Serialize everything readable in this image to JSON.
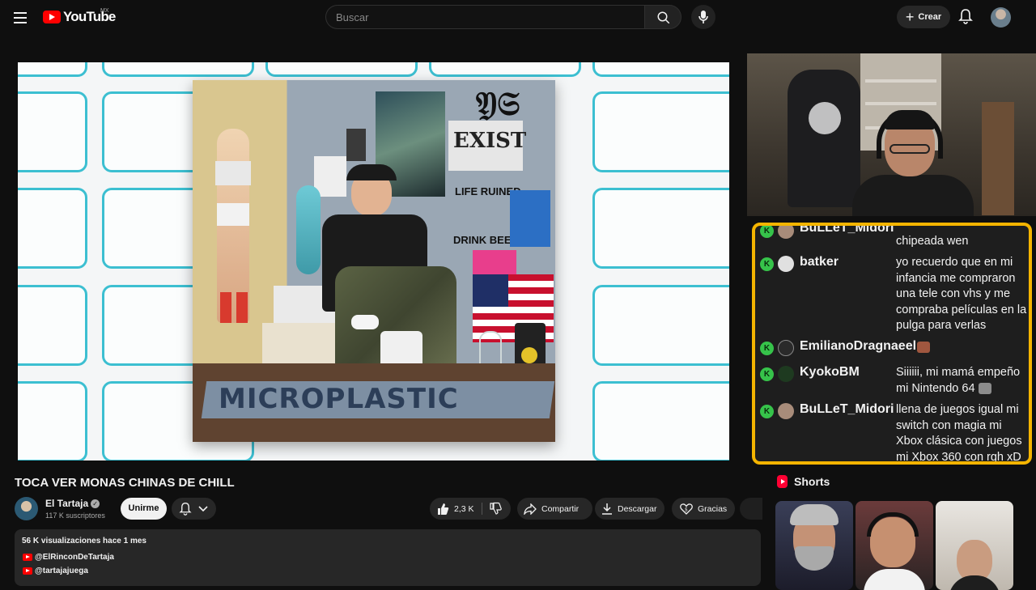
{
  "header": {
    "logo_text": "YouTube",
    "country_code": "MX",
    "search_placeholder": "Buscar",
    "create_label": "Crear"
  },
  "player": {
    "album_text": "MICROPLASTIC",
    "poster_texts": [
      "EXIST",
      "LIFE RUINED",
      "DRINK BEER"
    ]
  },
  "chat": {
    "messages": [
      {
        "user": "BuLLeT_Midori",
        "text": "chipeada wen",
        "badge": "K",
        "accent": "#36c34a"
      },
      {
        "user": "batker",
        "text": "yo recuerdo que en mi infancia me compraron una tele con vhs y me compraba películas en la pulga para verlas",
        "badge": "K",
        "accent": "#36c34a"
      },
      {
        "user": "EmilianoDragnaeel",
        "text": "",
        "badge": "K",
        "accent": "#36c34a"
      },
      {
        "user": "KyokoBM",
        "text": "Siiiiii, mi mamá empeño mi Nintendo 64",
        "badge": "K",
        "accent": "#36c34a"
      },
      {
        "user": "BuLLeT_Midori",
        "text": "llena de juegos igual mi switch con magia mi Xbox clásica con juegos mi Xbox 360 con rgh xD",
        "badge": "K",
        "accent": "#36c34a"
      }
    ],
    "border_color": "#f4b400"
  },
  "video": {
    "title": "TOCA VER MONAS CHINAS DE CHILL",
    "channel_name": "El Tartaja",
    "subscribers": "117 K suscriptores",
    "join_label": "Unirme",
    "likes": "2,3 K",
    "share_label": "Compartir",
    "download_label": "Descargar",
    "thanks_label": "Gracias"
  },
  "description": {
    "meta": "56 K visualizaciones  hace 1 mes",
    "links": [
      "@ElRinconDeTartaja",
      "@tartajajuega"
    ]
  },
  "shorts": {
    "title": "Shorts"
  }
}
